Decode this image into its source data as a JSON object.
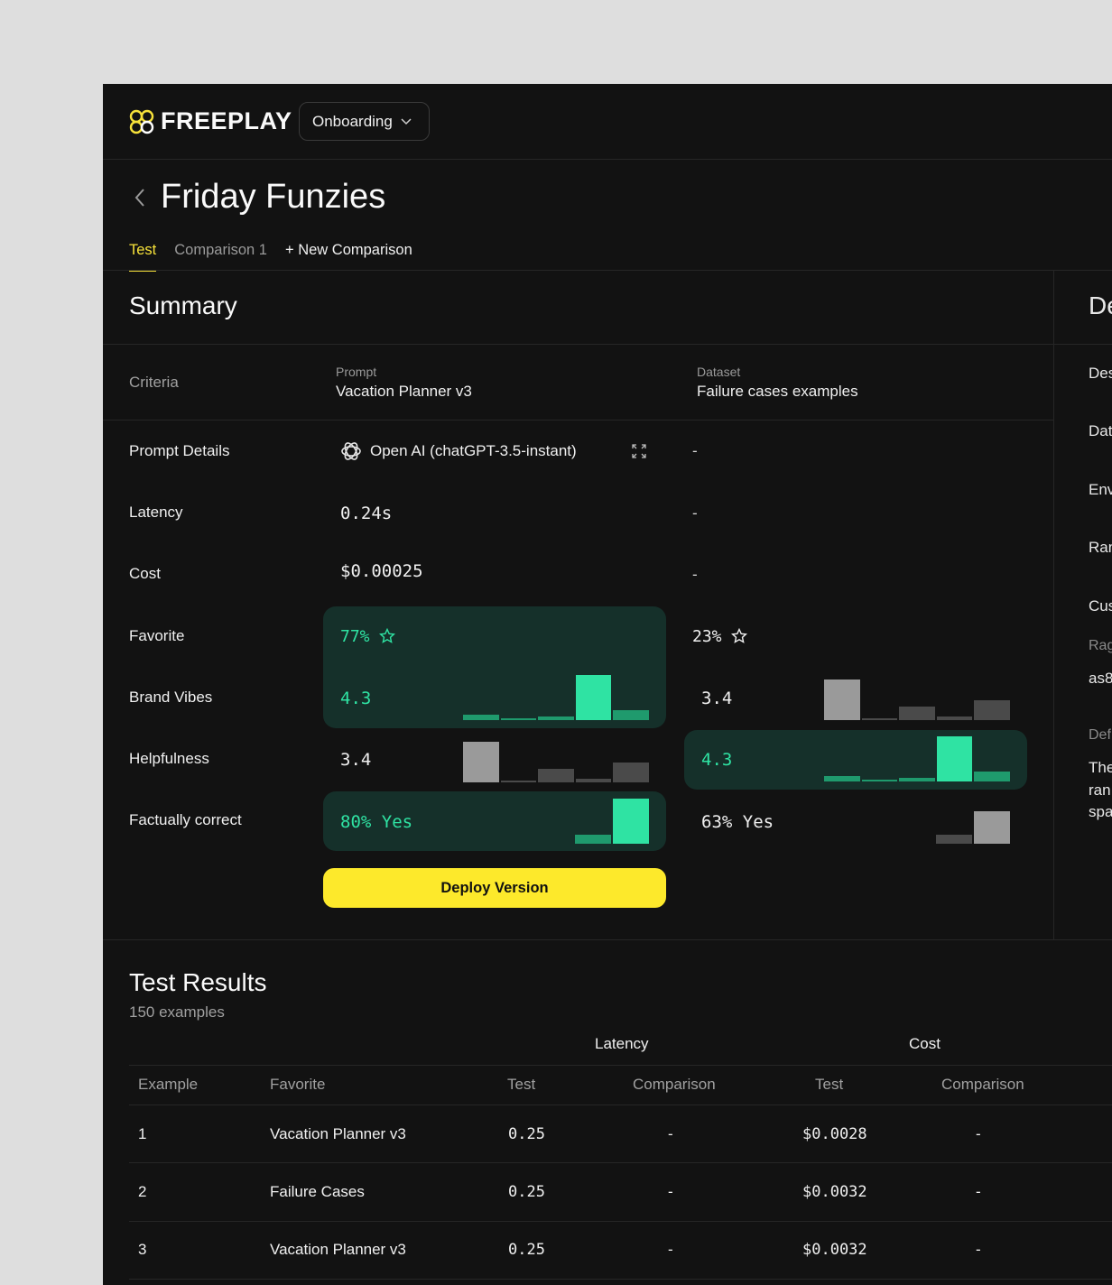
{
  "app": {
    "brand": "FREEPLAY",
    "workspace": "Onboarding"
  },
  "page": {
    "title": "Friday Funzies",
    "tabs": [
      {
        "label": "Test",
        "active": true
      },
      {
        "label": "Comparison 1",
        "active": false
      },
      {
        "label": "+ New Comparison",
        "active": false
      }
    ]
  },
  "summary": {
    "title": "Summary",
    "criteria_label": "Criteria",
    "prompt": {
      "label": "Prompt",
      "value": "Vacation Planner v3"
    },
    "dataset": {
      "label": "Dataset",
      "value": "Failure cases examples"
    },
    "rows": {
      "prompt_details": {
        "label": "Prompt Details",
        "test": "Open AI (chatGPT-3.5-instant)",
        "comparison": "-"
      },
      "latency": {
        "label": "Latency",
        "test": "0.24s",
        "comparison": "-"
      },
      "cost": {
        "label": "Cost",
        "test": "$0.00025",
        "comparison": "-"
      },
      "favorite": {
        "label": "Favorite",
        "test": "77%",
        "comparison": "23%"
      },
      "brand_vibes": {
        "label": "Brand Vibes",
        "test": "4.3",
        "comparison": "3.4",
        "test_dist": [
          0.12,
          0.03,
          0.08,
          1.0,
          0.22
        ],
        "comparison_dist": [
          1.0,
          0.03,
          0.33,
          0.1,
          0.5
        ]
      },
      "helpfulness": {
        "label": "Helpfulness",
        "test": "3.4",
        "comparison": "4.3",
        "test_dist": [
          1.0,
          0.03,
          0.33,
          0.1,
          0.5
        ],
        "comparison_dist": [
          0.12,
          0.03,
          0.08,
          1.0,
          0.22
        ]
      },
      "factually_correct": {
        "label": "Factually correct",
        "test": "80%",
        "test_suffix": "Yes",
        "comparison": "63%",
        "comparison_suffix": "Yes",
        "test_dist": [
          0.2,
          1.0
        ],
        "comparison_dist": [
          0.28,
          1.0
        ]
      }
    },
    "deploy_label": "Deploy Version"
  },
  "side_panel": {
    "title": "De",
    "items": [
      "Des",
      "Dat",
      "Env",
      "Ran",
      "Cus",
      "Rag",
      "as8",
      "Def",
      "The",
      "ran",
      "spa"
    ]
  },
  "results": {
    "title": "Test Results",
    "subtitle": "150 examples",
    "groups": {
      "latency": "Latency",
      "cost": "Cost"
    },
    "columns": [
      "Example",
      "Favorite",
      "Test",
      "Comparison",
      "Test",
      "Comparison"
    ],
    "rows": [
      [
        "1",
        "Vacation Planner v3",
        "0.25",
        "-",
        "$0.0028",
        "-"
      ],
      [
        "2",
        "Failure Cases",
        "0.25",
        "-",
        "$0.0032",
        "-"
      ],
      [
        "3",
        "Vacation Planner v3",
        "0.25",
        "-",
        "$0.0032",
        "-"
      ]
    ]
  },
  "colors": {
    "accent_yellow": "#fde92b",
    "accent_green": "#2fe3a3",
    "highlight_bg": "#15302a",
    "neutral_bar": "#9a9a9a"
  }
}
